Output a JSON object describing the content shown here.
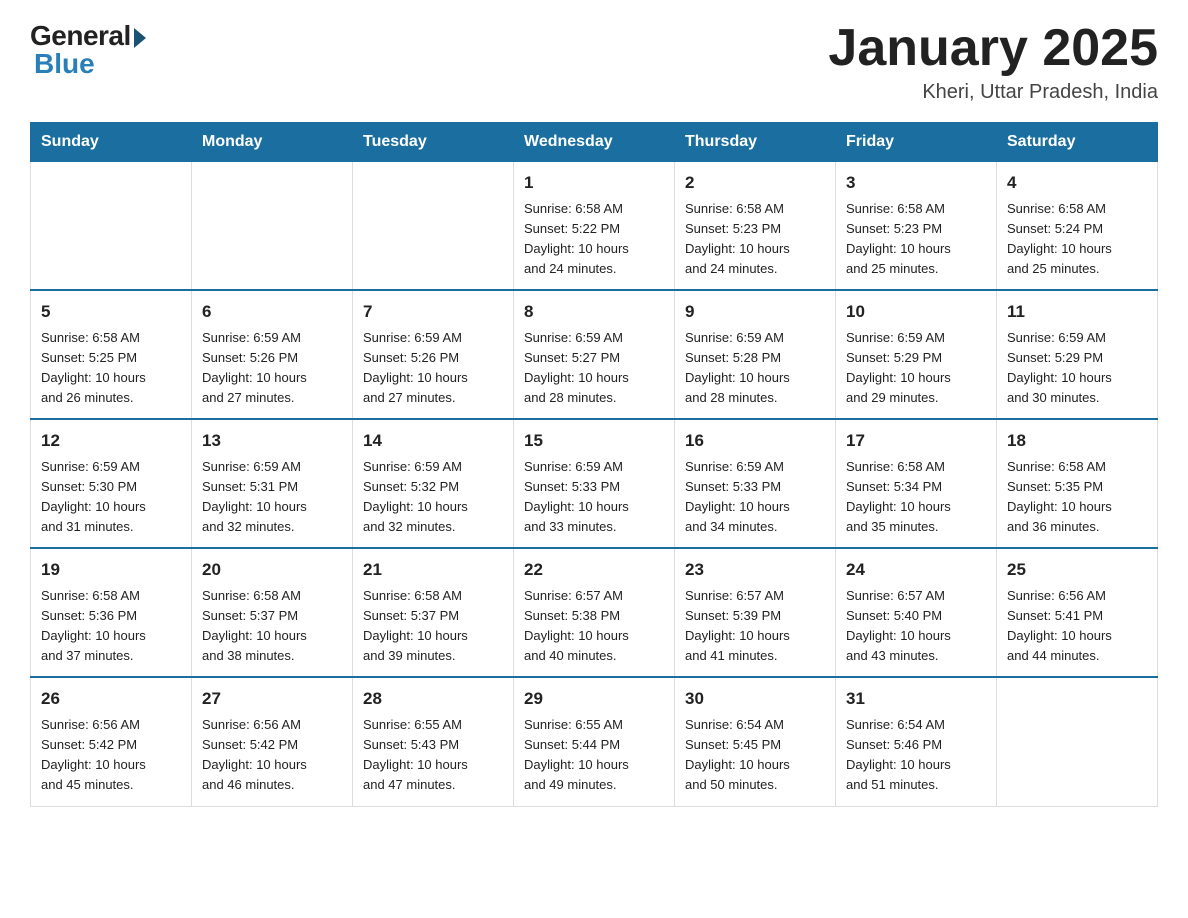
{
  "logo": {
    "general": "General",
    "blue": "Blue"
  },
  "header": {
    "title": "January 2025",
    "location": "Kheri, Uttar Pradesh, India"
  },
  "days_of_week": [
    "Sunday",
    "Monday",
    "Tuesday",
    "Wednesday",
    "Thursday",
    "Friday",
    "Saturday"
  ],
  "weeks": [
    [
      {
        "day": "",
        "info": ""
      },
      {
        "day": "",
        "info": ""
      },
      {
        "day": "",
        "info": ""
      },
      {
        "day": "1",
        "info": "Sunrise: 6:58 AM\nSunset: 5:22 PM\nDaylight: 10 hours\nand 24 minutes."
      },
      {
        "day": "2",
        "info": "Sunrise: 6:58 AM\nSunset: 5:23 PM\nDaylight: 10 hours\nand 24 minutes."
      },
      {
        "day": "3",
        "info": "Sunrise: 6:58 AM\nSunset: 5:23 PM\nDaylight: 10 hours\nand 25 minutes."
      },
      {
        "day": "4",
        "info": "Sunrise: 6:58 AM\nSunset: 5:24 PM\nDaylight: 10 hours\nand 25 minutes."
      }
    ],
    [
      {
        "day": "5",
        "info": "Sunrise: 6:58 AM\nSunset: 5:25 PM\nDaylight: 10 hours\nand 26 minutes."
      },
      {
        "day": "6",
        "info": "Sunrise: 6:59 AM\nSunset: 5:26 PM\nDaylight: 10 hours\nand 27 minutes."
      },
      {
        "day": "7",
        "info": "Sunrise: 6:59 AM\nSunset: 5:26 PM\nDaylight: 10 hours\nand 27 minutes."
      },
      {
        "day": "8",
        "info": "Sunrise: 6:59 AM\nSunset: 5:27 PM\nDaylight: 10 hours\nand 28 minutes."
      },
      {
        "day": "9",
        "info": "Sunrise: 6:59 AM\nSunset: 5:28 PM\nDaylight: 10 hours\nand 28 minutes."
      },
      {
        "day": "10",
        "info": "Sunrise: 6:59 AM\nSunset: 5:29 PM\nDaylight: 10 hours\nand 29 minutes."
      },
      {
        "day": "11",
        "info": "Sunrise: 6:59 AM\nSunset: 5:29 PM\nDaylight: 10 hours\nand 30 minutes."
      }
    ],
    [
      {
        "day": "12",
        "info": "Sunrise: 6:59 AM\nSunset: 5:30 PM\nDaylight: 10 hours\nand 31 minutes."
      },
      {
        "day": "13",
        "info": "Sunrise: 6:59 AM\nSunset: 5:31 PM\nDaylight: 10 hours\nand 32 minutes."
      },
      {
        "day": "14",
        "info": "Sunrise: 6:59 AM\nSunset: 5:32 PM\nDaylight: 10 hours\nand 32 minutes."
      },
      {
        "day": "15",
        "info": "Sunrise: 6:59 AM\nSunset: 5:33 PM\nDaylight: 10 hours\nand 33 minutes."
      },
      {
        "day": "16",
        "info": "Sunrise: 6:59 AM\nSunset: 5:33 PM\nDaylight: 10 hours\nand 34 minutes."
      },
      {
        "day": "17",
        "info": "Sunrise: 6:58 AM\nSunset: 5:34 PM\nDaylight: 10 hours\nand 35 minutes."
      },
      {
        "day": "18",
        "info": "Sunrise: 6:58 AM\nSunset: 5:35 PM\nDaylight: 10 hours\nand 36 minutes."
      }
    ],
    [
      {
        "day": "19",
        "info": "Sunrise: 6:58 AM\nSunset: 5:36 PM\nDaylight: 10 hours\nand 37 minutes."
      },
      {
        "day": "20",
        "info": "Sunrise: 6:58 AM\nSunset: 5:37 PM\nDaylight: 10 hours\nand 38 minutes."
      },
      {
        "day": "21",
        "info": "Sunrise: 6:58 AM\nSunset: 5:37 PM\nDaylight: 10 hours\nand 39 minutes."
      },
      {
        "day": "22",
        "info": "Sunrise: 6:57 AM\nSunset: 5:38 PM\nDaylight: 10 hours\nand 40 minutes."
      },
      {
        "day": "23",
        "info": "Sunrise: 6:57 AM\nSunset: 5:39 PM\nDaylight: 10 hours\nand 41 minutes."
      },
      {
        "day": "24",
        "info": "Sunrise: 6:57 AM\nSunset: 5:40 PM\nDaylight: 10 hours\nand 43 minutes."
      },
      {
        "day": "25",
        "info": "Sunrise: 6:56 AM\nSunset: 5:41 PM\nDaylight: 10 hours\nand 44 minutes."
      }
    ],
    [
      {
        "day": "26",
        "info": "Sunrise: 6:56 AM\nSunset: 5:42 PM\nDaylight: 10 hours\nand 45 minutes."
      },
      {
        "day": "27",
        "info": "Sunrise: 6:56 AM\nSunset: 5:42 PM\nDaylight: 10 hours\nand 46 minutes."
      },
      {
        "day": "28",
        "info": "Sunrise: 6:55 AM\nSunset: 5:43 PM\nDaylight: 10 hours\nand 47 minutes."
      },
      {
        "day": "29",
        "info": "Sunrise: 6:55 AM\nSunset: 5:44 PM\nDaylight: 10 hours\nand 49 minutes."
      },
      {
        "day": "30",
        "info": "Sunrise: 6:54 AM\nSunset: 5:45 PM\nDaylight: 10 hours\nand 50 minutes."
      },
      {
        "day": "31",
        "info": "Sunrise: 6:54 AM\nSunset: 5:46 PM\nDaylight: 10 hours\nand 51 minutes."
      },
      {
        "day": "",
        "info": ""
      }
    ]
  ]
}
